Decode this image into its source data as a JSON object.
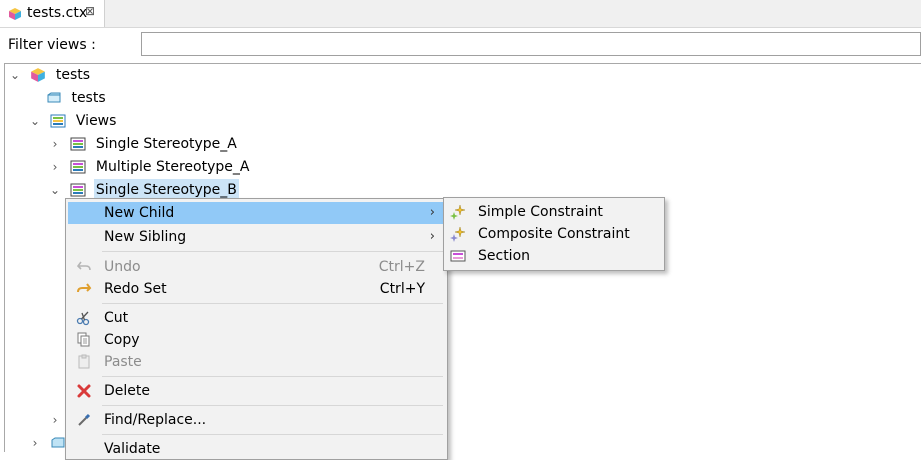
{
  "tab": {
    "title": "tests.ctx",
    "close_glyph": "⊠",
    "icon": "cube-icon"
  },
  "filter": {
    "label": "Filter views :",
    "value": "",
    "placeholder": ""
  },
  "tree": {
    "items": [
      {
        "label": "tests",
        "icon": "cube-icon",
        "expanded": true
      },
      {
        "label": "tests",
        "icon": "folder-icon"
      },
      {
        "label": "Views",
        "icon": "views-icon",
        "expanded": true
      },
      {
        "label": "Single Stereotype_A",
        "icon": "view-icon",
        "expanded": false
      },
      {
        "label": "Multiple Stereotype_A",
        "icon": "view-icon",
        "expanded": false
      },
      {
        "label": "Single Stereotype_B",
        "icon": "view-icon",
        "expanded": true,
        "selected": true
      }
    ]
  },
  "context_menu": {
    "items": [
      {
        "label": "New Child",
        "submenu": true,
        "highlighted": true
      },
      {
        "label": "New Sibling",
        "submenu": true
      },
      {
        "label": "Undo",
        "shortcut": "Ctrl+Z",
        "disabled": true,
        "icon": "undo-icon"
      },
      {
        "label": "Redo Set",
        "shortcut": "Ctrl+Y",
        "icon": "redo-icon"
      },
      {
        "label": "Cut",
        "icon": "scissors-icon"
      },
      {
        "label": "Copy",
        "icon": "copy-icon"
      },
      {
        "label": "Paste",
        "disabled": true,
        "icon": "paste-icon"
      },
      {
        "label": "Delete",
        "icon": "delete-icon"
      },
      {
        "label": "Find/Replace...",
        "icon": "find-replace-icon"
      },
      {
        "label": "Validate"
      }
    ],
    "submenu_arrow": "›"
  },
  "submenu": {
    "items": [
      {
        "label": "Simple Constraint",
        "icon": "sparkle-icon"
      },
      {
        "label": "Composite Constraint",
        "icon": "sparkle-icon"
      },
      {
        "label": "Section",
        "icon": "section-icon"
      }
    ]
  },
  "colors": {
    "highlight": "#91c9f7",
    "selection": "#cce4f7",
    "menu_bg": "#f2f2f2"
  }
}
